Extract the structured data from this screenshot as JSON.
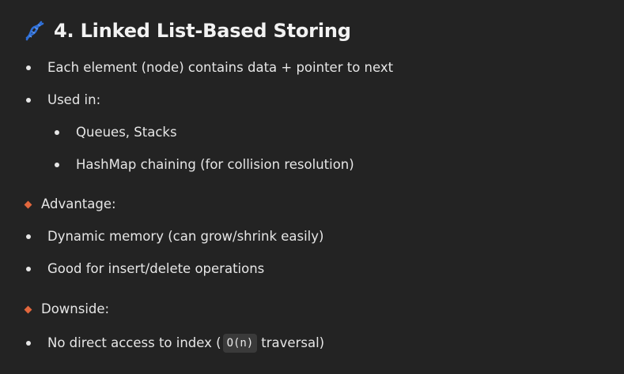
{
  "heading": {
    "icon": "dna-icon",
    "title": "4. Linked List-Based Storing"
  },
  "items": {
    "node_desc": "Each element (node) contains data + pointer to next",
    "used_in": "Used in:",
    "queues": "Queues, Stacks",
    "hashmap": "HashMap chaining (for collision resolution)",
    "advantage": "Advantage:",
    "dynamic": "Dynamic memory (can grow/shrink easily)",
    "good_for": "Good for insert/delete operations",
    "downside": "Downside:",
    "no_access_pre": "No direct access to index (",
    "no_access_code": "O(n)",
    "no_access_post": "traversal)"
  },
  "colors": {
    "background": "#232323",
    "text": "#e6e6e6",
    "diamond": "#e2673d",
    "dna_icon": "#2f6fd6"
  }
}
